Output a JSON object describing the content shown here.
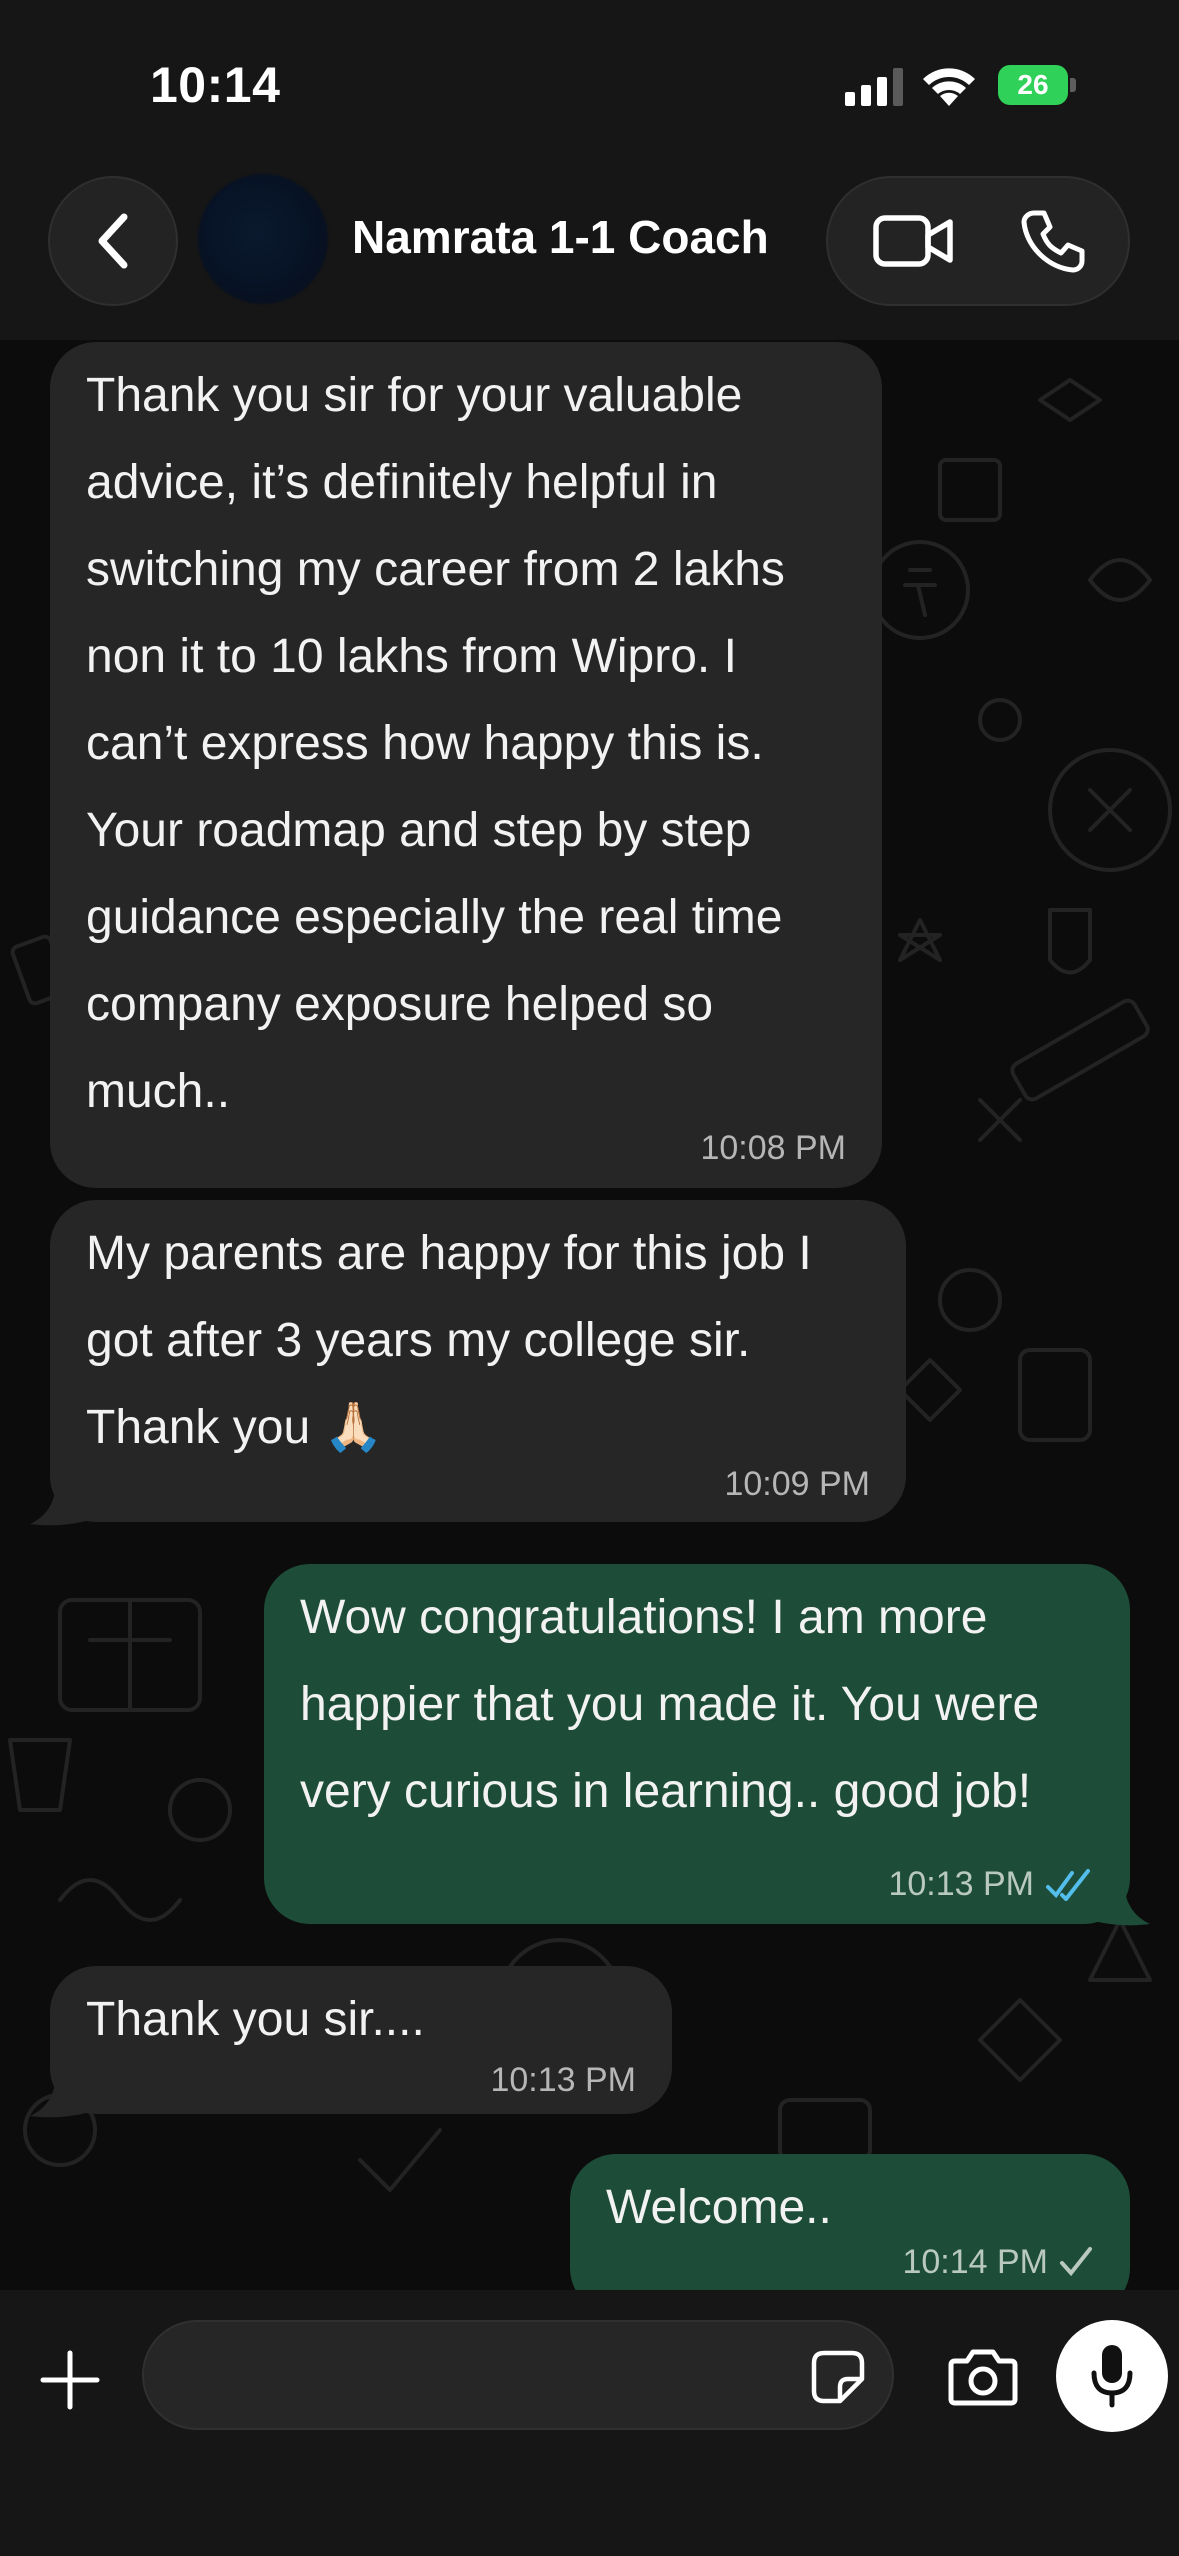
{
  "status_bar": {
    "time": "10:14",
    "battery_level": "26",
    "battery_color": "#30d158",
    "icons": [
      "signal-icon",
      "wifi-icon",
      "battery-icon"
    ]
  },
  "header": {
    "contact_name": "Namrata 1-1 Coach",
    "icons": [
      "back-icon",
      "video-call-icon",
      "voice-call-icon"
    ]
  },
  "messages": [
    {
      "direction": "incoming",
      "text": "Thank you sir for your valuable\nadvice, it’s definitely helpful in\nswitching my career from 2 lakhs\nnon it to 10 lakhs from Wipro. I\ncan’t express how happy this is.\nYour roadmap and step by step\nguidance especially the real time\ncompany exposure helped so\nmuch..",
      "time": "10:08 PM"
    },
    {
      "direction": "incoming",
      "text": "My parents are happy for this job I\ngot after 3 years my college sir.\nThank you 🙏🏻",
      "time": "10:09 PM"
    },
    {
      "direction": "outgoing",
      "text": "Wow congratulations! I am more\nhappier that you made it. You were\nvery curious in learning.. good job!",
      "time": "10:13 PM",
      "status": "read"
    },
    {
      "direction": "incoming",
      "text": "Thank you sir....",
      "time": "10:13 PM"
    },
    {
      "direction": "outgoing",
      "text": "Welcome..",
      "time": "10:14 PM",
      "status": "sent"
    }
  ],
  "colors": {
    "incoming_bubble": "#262626",
    "outgoing_bubble": "#1d4d38",
    "read_tick": "#53bdeb",
    "background": "#0b0b0b"
  },
  "input_bar": {
    "message_value": "",
    "icons": [
      "plus-icon",
      "sticker-icon",
      "camera-icon",
      "microphone-icon"
    ]
  }
}
